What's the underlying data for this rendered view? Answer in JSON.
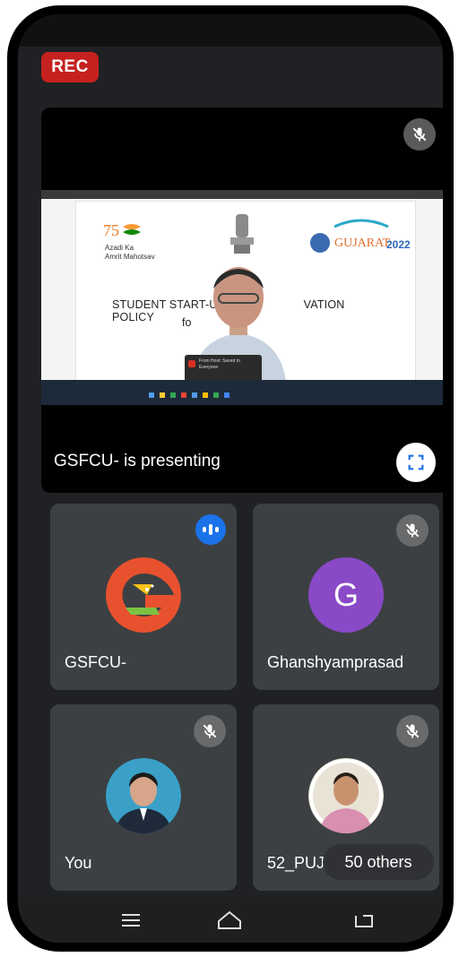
{
  "rec_badge": "REC",
  "presentation": {
    "caption": "GSFCU- is presenting",
    "slide_title_line1": "STUDENT START-UP",
    "slide_title_line1b": "VATION POLICY",
    "slide_title_line2": "fo",
    "azadi_text": "Azadi Ka Amrit Mahotsav",
    "gujarat_text": "GUJARAT",
    "gujarat_year": "2022",
    "chat_popup": "From Host: Saved to Everyone",
    "mic_icon": "mic-off-icon",
    "fullscreen_icon": "fullscreen-icon"
  },
  "participants": [
    {
      "name": "GSFCU-",
      "state": "speaking",
      "avatar": "gsfcu-logo"
    },
    {
      "name": "Ghanshyamprasad",
      "state": "muted",
      "avatar_letter": "G",
      "avatar_color": "#8a49c7"
    },
    {
      "name": "You",
      "state": "muted",
      "avatar": "photo"
    },
    {
      "name": "52_PUJ",
      "state": "muted",
      "avatar": "photo"
    }
  ],
  "others_badge": "50 others",
  "navbar": {
    "menu_icon": "menu-icon",
    "home_icon": "home-icon",
    "back_icon": "back-icon"
  },
  "colors": {
    "accent": "#1a73e8",
    "rec": "#c5221f",
    "tile": "#3c4043",
    "background": "#202124"
  }
}
